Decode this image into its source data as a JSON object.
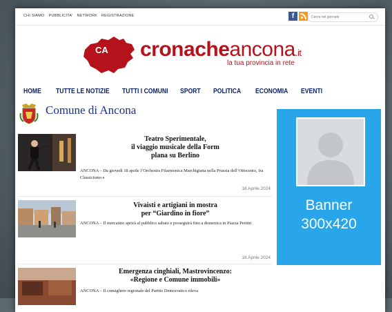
{
  "topbar": {
    "links": [
      "CHI SIAMO",
      "PUBBLICITA'",
      "NETWORK",
      "REGISTRAZIONE"
    ],
    "search_placeholder": "Cerca nel giornale",
    "icons": [
      "facebook-icon",
      "rss-icon",
      "search-icon"
    ]
  },
  "logo": {
    "badge": "CA",
    "cronache": "cronache",
    "ancona": "ancona",
    "tld": ".it",
    "tagline": "la tua provincia in rete"
  },
  "nav": {
    "items": [
      "HOME",
      "TUTTE LE NOTIZIE",
      "TUTTI I COMUNI",
      "SPORT",
      "POLITICA",
      "ECONOMIA",
      "EVENTI"
    ]
  },
  "section": {
    "title": "Comune di Ancona"
  },
  "articles": [
    {
      "headline": "Teatro Sperimentale,\nil viaggio musicale della Form\nplana su Berlino",
      "excerpt": "ANCONA – Da giovedì 18 aprile l’Orchestra Filarmonica Marchigiana nella Prussia dell’Ottocento, fra Classicismo e",
      "date": "16 Aprile 2024"
    },
    {
      "headline": "Vivaisti e artigiani in mostra\nper “Giardino in fiore”",
      "excerpt": "ANCONA – Il mercatino aprirà al pubblico sabato e proseguirà fino a domenica in Piazza Pertini",
      "date": "16 Aprile 2024"
    },
    {
      "headline": "Emergenza cinghiali, Mastrovincenzo:\n«Regione e Comune immobili»",
      "excerpt": "ANCONA – Il consigliere regionale del Partito Democratico rileva",
      "date": ""
    }
  ],
  "banner": {
    "line1": "Banner",
    "line2": "300x420",
    "color": "#29a6ea"
  },
  "colors": {
    "brand_red": "#b5121b",
    "nav_blue": "#0b1f66",
    "section_blue": "#1a2f8a"
  }
}
